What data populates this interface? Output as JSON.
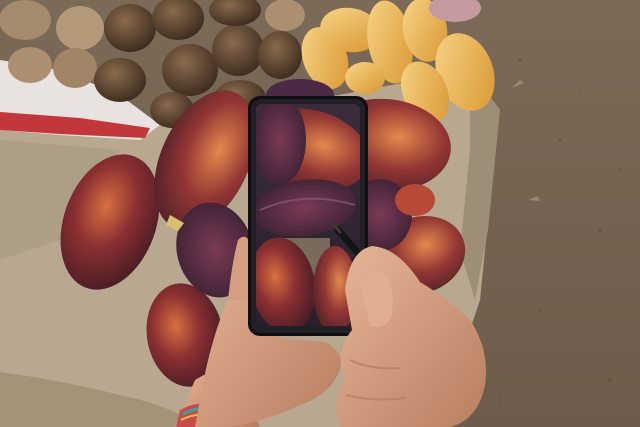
{
  "scene": {
    "colors": {
      "ground": "#756453",
      "ground_light": "#8a7a68",
      "sack": "#b9ab93",
      "sack_shadow": "#9c8e78",
      "pod_dark": "#4a1f28",
      "pod_mid": "#7a2c33",
      "pod_light": "#c85a3a",
      "pod_highlight": "#e79a5a",
      "yam": "#f2c26a",
      "yam_shadow": "#d69a3a",
      "potato": "#a68a6b",
      "potato_dark": "#4c3a2a",
      "skin": "#d9a88a",
      "skin_shadow": "#b67f62",
      "phone_body": "#101014",
      "stylus": "#1a1a1a"
    }
  }
}
